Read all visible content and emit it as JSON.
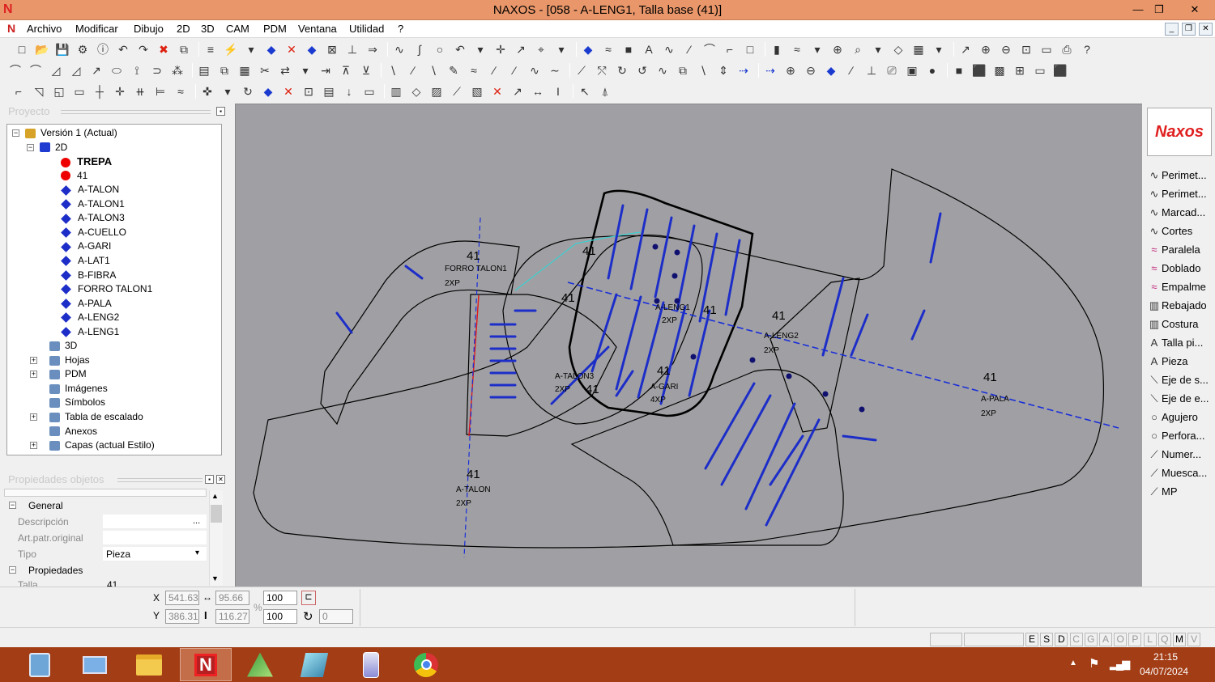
{
  "window": {
    "title": "NAXOS - [058 - A-LENG1, Talla base (41)]",
    "logo": "N",
    "controls": [
      "—",
      "❐",
      "✕"
    ]
  },
  "menu": {
    "items": [
      "Archivo",
      "Modificar",
      "Dibujo",
      "2D",
      "3D",
      "CAM",
      "PDM",
      "Ventana",
      "Utilidad",
      "?"
    ]
  },
  "project_panel": {
    "title": "Proyecto",
    "tree": [
      {
        "label": "Versión 1 (Actual)"
      },
      {
        "label": "2D"
      },
      {
        "label": "TREPA",
        "type": "red"
      },
      {
        "label": "41",
        "type": "red"
      },
      {
        "label": "A-TALON",
        "type": "blue"
      },
      {
        "label": "A-TALON1",
        "type": "blue"
      },
      {
        "label": "A-TALON3",
        "type": "blue"
      },
      {
        "label": "A-CUELLO",
        "type": "blue"
      },
      {
        "label": "A-GARI",
        "type": "blue"
      },
      {
        "label": "A-LAT1",
        "type": "blue"
      },
      {
        "label": "B-FIBRA",
        "type": "blue"
      },
      {
        "label": "FORRO TALON1",
        "type": "blue"
      },
      {
        "label": "A-PALA",
        "type": "blue"
      },
      {
        "label": "A-LENG2",
        "type": "blue"
      },
      {
        "label": "A-LENG1",
        "type": "blue"
      },
      {
        "label": "3D"
      },
      {
        "label": "Hojas"
      },
      {
        "label": "PDM"
      },
      {
        "label": "Imágenes"
      },
      {
        "label": "Símbolos"
      },
      {
        "label": "Tabla de escalado"
      },
      {
        "label": "Anexos"
      },
      {
        "label": "Capas (actual Estilo)"
      }
    ]
  },
  "props_panel": {
    "title": "Propiedades objetos",
    "group_general": "General",
    "rows": [
      {
        "label": "Descripción",
        "value": "",
        "btn": "..."
      },
      {
        "label": "Art.patr.original",
        "value": ""
      },
      {
        "label": "Tipo",
        "value": "Pieza",
        "btn": "▾"
      }
    ],
    "group_props": "Propiedades",
    "partial_row": "Talla",
    "partial_value": "41"
  },
  "right_panel": {
    "logo": "Naxos",
    "items": [
      "Perimet...",
      "Perimet...",
      "Marcad...",
      "Cortes",
      "Paralela",
      "Doblado",
      "Empalme",
      "Rebajado",
      "Costura",
      "Talla pi...",
      "Pieza",
      "Eje de s...",
      "Eje de e...",
      "Agujero",
      "Perfora...",
      "Numer...",
      "Muesca...",
      "MP"
    ]
  },
  "coords": {
    "x_label": "X",
    "x": "541.63",
    "y_label": "Y",
    "y": "386.31",
    "w": "95.66",
    "h": "116.27",
    "pct_label": "%",
    "sx": "100",
    "sy": "100",
    "angle": "0"
  },
  "status_letters": [
    "E",
    "S",
    "D",
    "C",
    "G",
    "A",
    "O",
    "P",
    "L",
    "Q",
    "M",
    "V"
  ],
  "taskbar": {
    "time": "21:15",
    "date": "04/07/2024"
  },
  "canvas_labels": [
    {
      "text": "41",
      "id": "l1"
    },
    {
      "text": "FORRO TALON1",
      "id": "l2"
    },
    {
      "text": "2XP",
      "id": "l3"
    },
    {
      "text": "41",
      "id": "l4"
    },
    {
      "text": "41",
      "id": "l5"
    },
    {
      "text": "A-LENG1",
      "id": "l6"
    },
    {
      "text": "41",
      "id": "l7"
    },
    {
      "text": "2XP",
      "id": "l8"
    },
    {
      "text": "41",
      "id": "l9"
    },
    {
      "text": "A-LENG2",
      "id": "l10"
    },
    {
      "text": "2XP",
      "id": "l11"
    },
    {
      "text": "A-TALON3",
      "id": "l12"
    },
    {
      "text": "2XP",
      "id": "l13"
    },
    {
      "text": "41",
      "id": "l14"
    },
    {
      "text": "41",
      "id": "l15"
    },
    {
      "text": "A-GARI",
      "id": "l16"
    },
    {
      "text": "4XP",
      "id": "l17"
    },
    {
      "text": "41",
      "id": "l18"
    },
    {
      "text": "A-PALA",
      "id": "l19"
    },
    {
      "text": "2XP",
      "id": "l20"
    },
    {
      "text": "41",
      "id": "l21"
    },
    {
      "text": "A-TALON",
      "id": "l22"
    },
    {
      "text": "2XP",
      "id": "l23"
    }
  ],
  "colors": {
    "titlebar": "#e9976a",
    "canvas_bg": "#a0a0a4",
    "taskbar": "#a33d16",
    "piece_blue": "#1d2ec8"
  }
}
